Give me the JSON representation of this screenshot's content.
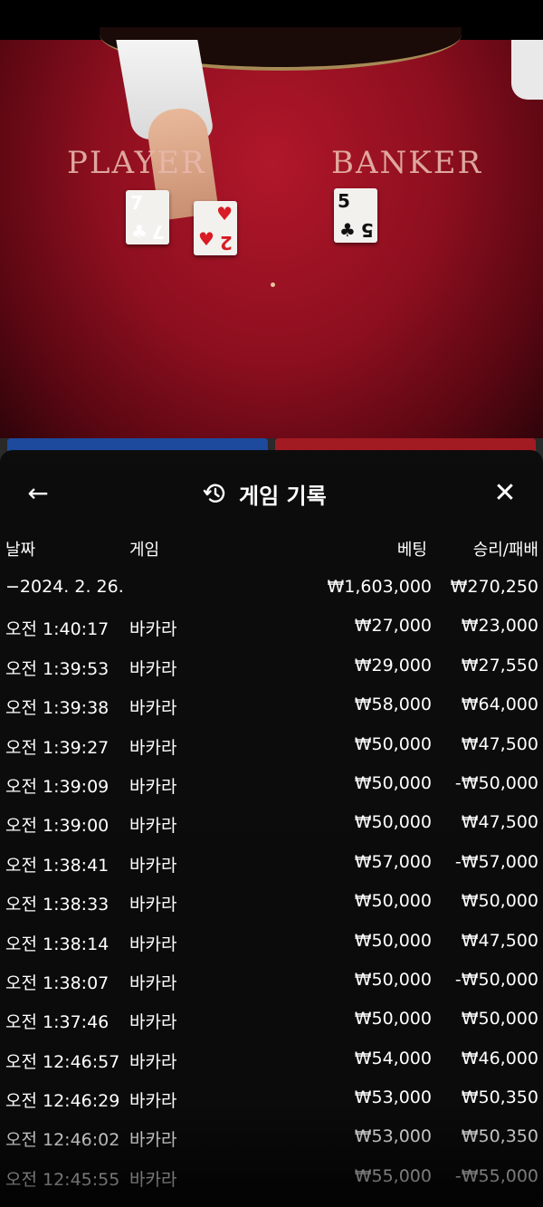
{
  "video": {
    "player_label": "PLAYER",
    "banker_label": "BANKER",
    "player_cards": [
      {
        "rank": "7",
        "suit": "♣",
        "color": "#111111"
      },
      {
        "rank": "2",
        "suit": "♥",
        "color": "#d81b24"
      }
    ],
    "banker_cards": [
      {
        "rank": "5",
        "suit": "♣",
        "color": "#111111"
      }
    ]
  },
  "panel": {
    "title": "게임 기록",
    "back_icon": "arrow-left-icon",
    "history_icon": "history-clock-icon",
    "close_icon": "close-x-icon"
  },
  "columns": {
    "date": "날짜",
    "game": "게임",
    "bet": "베팅",
    "result": "승리/패배"
  },
  "rows": [
    {
      "date": "−2024. 2. 26.",
      "game": "",
      "bet": "₩1,603,000",
      "result": "₩270,250"
    },
    {
      "date": "오전 1:40:17",
      "game": "바카라",
      "bet": "₩27,000",
      "result": "₩23,000"
    },
    {
      "date": "오전 1:39:53",
      "game": "바카라",
      "bet": "₩29,000",
      "result": "₩27,550"
    },
    {
      "date": "오전 1:39:38",
      "game": "바카라",
      "bet": "₩58,000",
      "result": "₩64,000"
    },
    {
      "date": "오전 1:39:27",
      "game": "바카라",
      "bet": "₩50,000",
      "result": "₩47,500"
    },
    {
      "date": "오전 1:39:09",
      "game": "바카라",
      "bet": "₩50,000",
      "result": "-₩50,000"
    },
    {
      "date": "오전 1:39:00",
      "game": "바카라",
      "bet": "₩50,000",
      "result": "₩47,500"
    },
    {
      "date": "오전 1:38:41",
      "game": "바카라",
      "bet": "₩57,000",
      "result": "-₩57,000"
    },
    {
      "date": "오전 1:38:33",
      "game": "바카라",
      "bet": "₩50,000",
      "result": "₩50,000"
    },
    {
      "date": "오전 1:38:14",
      "game": "바카라",
      "bet": "₩50,000",
      "result": "₩47,500"
    },
    {
      "date": "오전 1:38:07",
      "game": "바카라",
      "bet": "₩50,000",
      "result": "-₩50,000"
    },
    {
      "date": "오전 1:37:46",
      "game": "바카라",
      "bet": "₩50,000",
      "result": "₩50,000"
    },
    {
      "date": "오전 12:46:57",
      "game": "바카라",
      "bet": "₩54,000",
      "result": "₩46,000"
    },
    {
      "date": "오전 12:46:29",
      "game": "바카라",
      "bet": "₩53,000",
      "result": "₩50,350"
    },
    {
      "date": "오전 12:46:02",
      "game": "바카라",
      "bet": "₩53,000",
      "result": "₩50,350"
    },
    {
      "date": "오전 12:45:55",
      "game": "바카라",
      "bet": "₩55,000",
      "result": "-₩55,000"
    }
  ]
}
